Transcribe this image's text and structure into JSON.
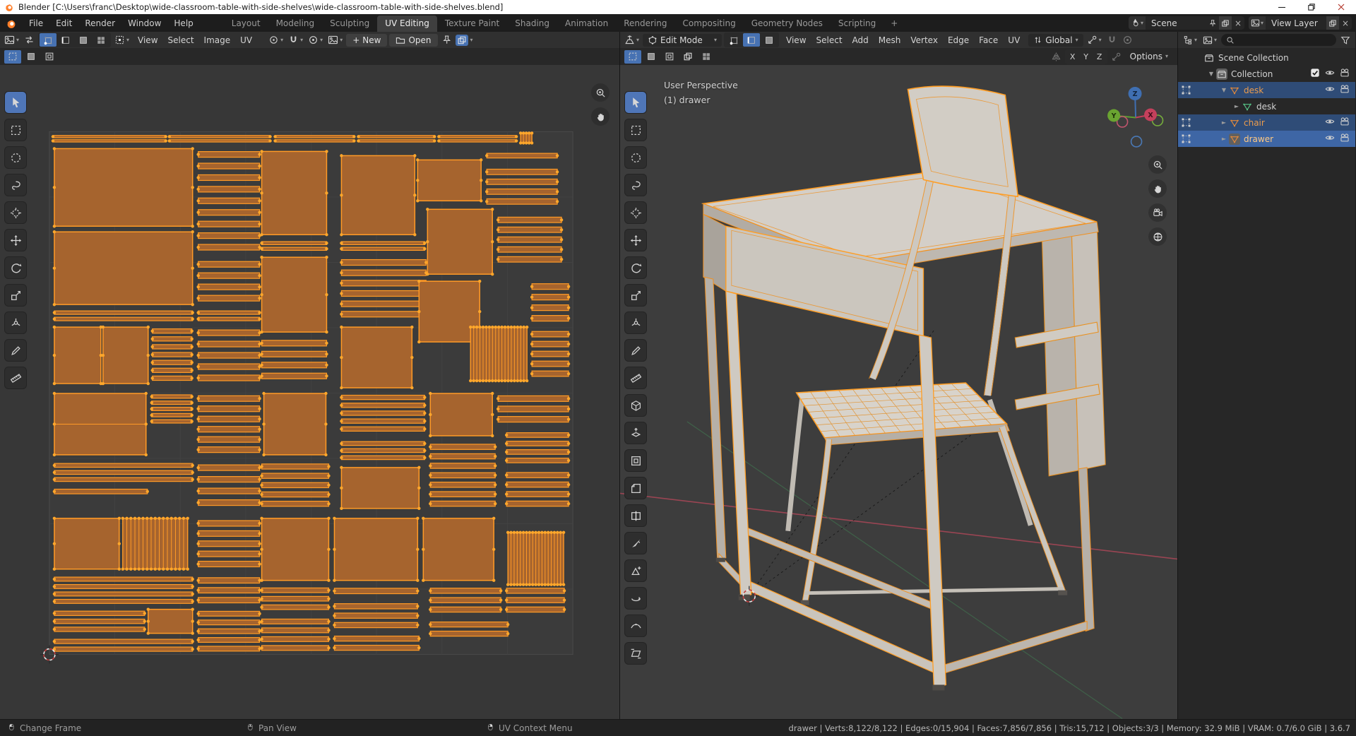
{
  "window": {
    "title": "Blender [C:\\Users\\franc\\Desktop\\wide-classroom-table-with-side-shelves\\wide-classroom-table-with-side-shelves.blend]"
  },
  "topbar": {
    "menus": [
      "File",
      "Edit",
      "Render",
      "Window",
      "Help"
    ],
    "workspaces": [
      "Layout",
      "Modeling",
      "Sculpting",
      "UV Editing",
      "Texture Paint",
      "Shading",
      "Animation",
      "Rendering",
      "Compositing",
      "Geometry Nodes",
      "Scripting"
    ],
    "active_workspace": "UV Editing",
    "add_workspace_label": "+",
    "scene": {
      "label": "Scene"
    },
    "view_layer": {
      "label": "View Layer"
    }
  },
  "uv_editor": {
    "menus": [
      "View",
      "Select",
      "Image",
      "UV"
    ],
    "new_button": "New",
    "open_button": "Open",
    "select_modes": [
      "vertex",
      "edge",
      "face",
      "island"
    ],
    "active_select_mode": "vertex",
    "tools": [
      "tweak",
      "select-box",
      "select-circle",
      "select-lasso",
      "cursor",
      "move",
      "rotate",
      "scale",
      "transform",
      "annotate",
      "measure"
    ],
    "active_tool": "tweak"
  },
  "viewport": {
    "mode": "Edit Mode",
    "menus": [
      "View",
      "Select",
      "Add",
      "Mesh",
      "Vertex",
      "Edge",
      "Face",
      "UV"
    ],
    "orientation": "Global",
    "options_button": "Options",
    "mirror_axes": [
      "X",
      "Y",
      "Z"
    ],
    "overlay": {
      "line1": "User Perspective",
      "line2": "(1) drawer"
    },
    "gizmo": {
      "x": "X",
      "y": "Y",
      "z": "Z"
    },
    "select_modes": [
      "vertex",
      "edge",
      "face"
    ],
    "active_select_mode": "edge",
    "tools": [
      "tweak",
      "select-box",
      "select-circle",
      "select-lasso",
      "cursor",
      "move",
      "rotate",
      "scale",
      "transform",
      "annotate",
      "measure",
      "add-cube",
      "extrude",
      "inset",
      "bevel",
      "loop-cut",
      "knife",
      "poly-build",
      "spin",
      "smooth",
      "shear"
    ],
    "active_tool": "tweak"
  },
  "outliner": {
    "rows": [
      {
        "label": "Scene Collection",
        "icon": "collection",
        "level": 0,
        "disclosure": "",
        "selected": false,
        "active": false,
        "editdots": false,
        "checkbox": false,
        "eye": false,
        "camera": false,
        "boxed": false,
        "tint": ""
      },
      {
        "label": "Collection",
        "icon": "collection",
        "level": 1,
        "disclosure": "down",
        "selected": false,
        "active": false,
        "editdots": false,
        "checkbox": true,
        "eye": true,
        "camera": true,
        "boxed": true,
        "tint": ""
      },
      {
        "label": "desk",
        "icon": "mesh",
        "level": 2,
        "disclosure": "down",
        "selected": true,
        "active": false,
        "editdots": true,
        "checkbox": false,
        "eye": true,
        "camera": true,
        "boxed": false,
        "tint": "orange"
      },
      {
        "label": "desk",
        "icon": "meshdata",
        "level": 3,
        "disclosure": "right",
        "selected": false,
        "active": false,
        "editdots": false,
        "checkbox": false,
        "eye": false,
        "camera": false,
        "boxed": false,
        "tint": ""
      },
      {
        "label": "chair",
        "icon": "mesh",
        "level": 2,
        "disclosure": "right",
        "selected": true,
        "active": false,
        "editdots": true,
        "checkbox": false,
        "eye": true,
        "camera": true,
        "boxed": false,
        "tint": "orange"
      },
      {
        "label": "drawer",
        "icon": "mesh",
        "level": 2,
        "disclosure": "right",
        "selected": true,
        "active": true,
        "editdots": true,
        "checkbox": false,
        "eye": true,
        "camera": true,
        "boxed": true,
        "tint": "bright"
      }
    ]
  },
  "statusbar": {
    "hints": [
      {
        "icon": "mouse-left",
        "label": "Change Frame"
      },
      {
        "icon": "mouse-middle",
        "label": "Pan View"
      },
      {
        "icon": "mouse-right",
        "label": "UV Context Menu"
      }
    ],
    "stats": "drawer | Verts:8,122/8,122 | Edges:0/15,904 | Faces:7,856/7,856 | Tris:15,712 | Objects:3/3 | Memory: 32.9 MiB | VRAM: 0.7/6.0 GiB | 3.6.7"
  },
  "colors": {
    "accent_blue": "#4772b3",
    "island_fill": "#a6642e",
    "island_edge": "#ff9a26",
    "island_vertex": "#ffa72b",
    "mesh_edge_orange": "#ff9d23",
    "axis_red": "#9a4553",
    "axis_green": "#3f5f48",
    "outliner_object_orange": "#eb9c4d",
    "outliner_active_text": "#ffc983"
  },
  "uv_islands": [
    [
      "h",
      5,
      4,
      160,
      12,
      2
    ],
    [
      "h",
      170,
      4,
      143,
      12,
      2
    ],
    [
      "h",
      320,
      4,
      112,
      12,
      2
    ],
    [
      "h",
      438,
      4,
      108,
      12,
      2
    ],
    [
      "h",
      552,
      4,
      110,
      12,
      2
    ],
    [
      "v",
      668,
      2,
      16,
      14,
      4
    ],
    [
      "r",
      7,
      24,
      196,
      110,
      0
    ],
    [
      "h",
      211,
      24,
      87,
      148,
      9
    ],
    [
      "r",
      301,
      28,
      92,
      118,
      0
    ],
    [
      "r",
      414,
      34,
      104,
      112,
      0
    ],
    [
      "r",
      522,
      40,
      90,
      58,
      0
    ],
    [
      "h",
      620,
      28,
      100,
      12,
      1
    ],
    [
      "h",
      620,
      50,
      100,
      56,
      4
    ],
    [
      "r",
      7,
      142,
      196,
      103,
      0
    ],
    [
      "h",
      301,
      154,
      92,
      16,
      2
    ],
    [
      "r",
      301,
      178,
      92,
      106,
      0
    ],
    [
      "h",
      414,
      154,
      118,
      16,
      2
    ],
    [
      "h",
      414,
      178,
      120,
      88,
      6
    ],
    [
      "r",
      536,
      110,
      92,
      92,
      0
    ],
    [
      "h",
      636,
      118,
      90,
      70,
      5
    ],
    [
      "h",
      7,
      252,
      196,
      18,
      2
    ],
    [
      "h",
      211,
      180,
      87,
      64,
      4
    ],
    [
      "h",
      211,
      252,
      87,
      18,
      2
    ],
    [
      "r",
      7,
      277,
      66,
      80,
      0
    ],
    [
      "r",
      76,
      277,
      64,
      80,
      0
    ],
    [
      "h",
      146,
      277,
      56,
      78,
      7
    ],
    [
      "h",
      211,
      277,
      87,
      80,
      5
    ],
    [
      "h",
      301,
      292,
      92,
      62,
      4
    ],
    [
      "r",
      414,
      277,
      100,
      86,
      0
    ],
    [
      "r",
      524,
      212,
      86,
      86,
      0
    ],
    [
      "v",
      597,
      277,
      80,
      76,
      18
    ],
    [
      "h",
      684,
      212,
      52,
      60,
      4
    ],
    [
      "h",
      684,
      280,
      52,
      70,
      5
    ],
    [
      "r",
      7,
      371,
      130,
      87,
      1
    ],
    [
      "h",
      145,
      371,
      57,
      44,
      5
    ],
    [
      "h",
      211,
      371,
      87,
      87,
      6
    ],
    [
      "r",
      304,
      371,
      88,
      87,
      0
    ],
    [
      "h",
      414,
      371,
      118,
      56,
      5
    ],
    [
      "r",
      540,
      371,
      88,
      60,
      0
    ],
    [
      "h",
      636,
      371,
      100,
      44,
      3
    ],
    [
      "h",
      7,
      468,
      196,
      30,
      3
    ],
    [
      "h",
      7,
      504,
      132,
      12,
      1
    ],
    [
      "h",
      211,
      468,
      87,
      66,
      4
    ],
    [
      "h",
      301,
      468,
      95,
      66,
      5
    ],
    [
      "h",
      414,
      437,
      118,
      30,
      3
    ],
    [
      "r",
      414,
      476,
      110,
      58,
      0
    ],
    [
      "h",
      540,
      440,
      92,
      94,
      7
    ],
    [
      "h",
      648,
      424,
      88,
      48,
      4
    ],
    [
      "h",
      648,
      480,
      88,
      54,
      4
    ],
    [
      "r",
      7,
      548,
      92,
      72,
      0
    ],
    [
      "v",
      104,
      548,
      92,
      72,
      16
    ],
    [
      "h",
      211,
      548,
      87,
      72,
      5
    ],
    [
      "r",
      301,
      548,
      95,
      88,
      0
    ],
    [
      "r",
      404,
      548,
      118,
      88,
      0
    ],
    [
      "r",
      530,
      548,
      100,
      88,
      0
    ],
    [
      "v",
      650,
      568,
      79,
      74,
      18
    ],
    [
      "h",
      7,
      629,
      196,
      42,
      4
    ],
    [
      "h",
      211,
      629,
      87,
      42,
      3
    ],
    [
      "h",
      7,
      677,
      128,
      34,
      3
    ],
    [
      "r",
      140,
      677,
      63,
      34,
      0
    ],
    [
      "h",
      211,
      677,
      87,
      62,
      5
    ],
    [
      "h",
      301,
      644,
      95,
      36,
      3
    ],
    [
      "h",
      301,
      688,
      95,
      50,
      4
    ],
    [
      "h",
      404,
      644,
      118,
      14,
      1
    ],
    [
      "h",
      404,
      666,
      118,
      40,
      3
    ],
    [
      "h",
      404,
      712,
      120,
      26,
      2
    ],
    [
      "h",
      540,
      644,
      100,
      40,
      3
    ],
    [
      "h",
      648,
      644,
      82,
      40,
      3
    ],
    [
      "h",
      7,
      717,
      196,
      22,
      2
    ],
    [
      "h",
      540,
      692,
      110,
      26,
      2
    ]
  ]
}
